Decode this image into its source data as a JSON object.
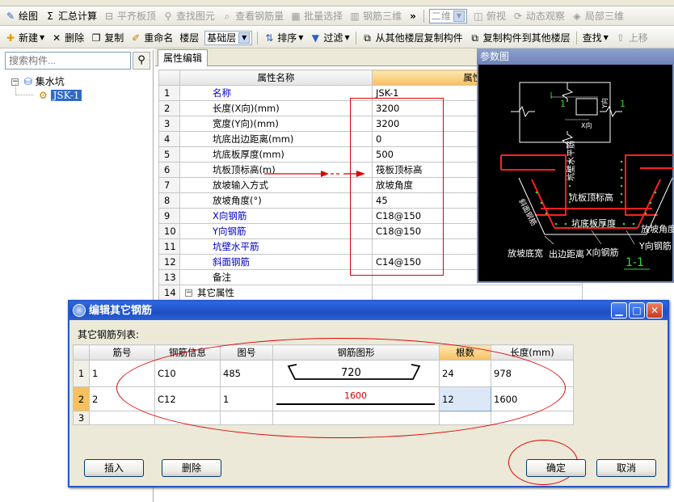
{
  "toolbar1": {
    "items": [
      {
        "label": "绘图",
        "icon": "draw-icon",
        "disabled": false
      },
      {
        "label": "汇总计算",
        "icon": "sigma-icon",
        "disabled": false
      },
      {
        "label": "平齐板顶",
        "icon": "align-icon",
        "disabled": true
      },
      {
        "label": "查找图元",
        "icon": "find-element-icon",
        "disabled": true
      },
      {
        "label": "查看钢筋量",
        "icon": "view-rebar-icon",
        "disabled": true
      },
      {
        "label": "批量选择",
        "icon": "batch-select-icon",
        "disabled": true
      },
      {
        "label": "钢筋三维",
        "icon": "rebar-3d-icon",
        "disabled": true
      }
    ],
    "overflow": "»",
    "view_combo": "二维",
    "top_view": "俯视",
    "dynamic": "动态观察",
    "local3d": "局部三维"
  },
  "toolbar2": {
    "new": "新建",
    "delete": "删除",
    "copy": "复制",
    "rename": "重命名",
    "floor": "楼层",
    "floor_value": "基础层",
    "sort": "排序",
    "filter": "过滤",
    "copy_from": "从其他楼层复制构件",
    "copy_to": "复制构件到其他楼层",
    "find": "查找",
    "move_up": "上移"
  },
  "left": {
    "search_placeholder": "搜索构件...",
    "tree_root": "集水坑",
    "tree_child": "JSK-1"
  },
  "props": {
    "tab": "属性编辑",
    "col_name": "属性名称",
    "col_value": "属性值",
    "rows": [
      {
        "n": "1",
        "name": "名称",
        "value": "JSK-1",
        "blue": true
      },
      {
        "n": "2",
        "name": "长度(X向)(mm)",
        "value": "3200",
        "blue": false
      },
      {
        "n": "3",
        "name": "宽度(Y向)(mm)",
        "value": "3200",
        "blue": false
      },
      {
        "n": "4",
        "name": "坑底出边距离(mm)",
        "value": "0",
        "blue": false
      },
      {
        "n": "5",
        "name": "坑底板厚度(mm)",
        "value": "500",
        "blue": false
      },
      {
        "n": "6",
        "name": "坑板顶标高(m)",
        "value": "筏板顶标高",
        "blue": false
      },
      {
        "n": "7",
        "name": "放坡输入方式",
        "value": "放坡角度",
        "blue": false
      },
      {
        "n": "8",
        "name": "放坡角度(°)",
        "value": "45",
        "blue": false
      },
      {
        "n": "9",
        "name": "X向钢筋",
        "value": "C18@150",
        "blue": true
      },
      {
        "n": "10",
        "name": "Y向钢筋",
        "value": "C18@150",
        "blue": true
      },
      {
        "n": "11",
        "name": "坑壁水平筋",
        "value": "",
        "blue": true
      },
      {
        "n": "12",
        "name": "斜面钢筋",
        "value": "C14@150",
        "blue": true
      },
      {
        "n": "13",
        "name": "备注",
        "value": "",
        "blue": false
      },
      {
        "n": "14",
        "name": "其它属性",
        "value": "",
        "blue": false
      }
    ]
  },
  "ref": {
    "title": "参数图",
    "lbl_1a": "1",
    "lbl_1b": "1",
    "lbl_y": "Y向",
    "lbl_x": "X向",
    "lbl_wall": "坑壁水平筋",
    "lbl_top": "坑板顶标高",
    "lbl_thick": "坑底板厚度",
    "lbl_slope_rebar": "斜面钢筋",
    "lbl_slope_angle": "放坡角度",
    "lbl_y_rebar": "Y向钢筋",
    "lbl_x_rebar": "X向钢筋",
    "lbl_slope_width": "放坡底宽",
    "lbl_edge": "出边距离",
    "lbl_section": "1-1"
  },
  "dialog": {
    "title": "编辑其它钢筋",
    "list_label": "其它钢筋列表:",
    "headers": [
      "筋号",
      "钢筋信息",
      "图号",
      "钢筋图形",
      "根数",
      "长度(mm)"
    ],
    "rows": [
      {
        "rn": "1",
        "no": "1",
        "info": "C10",
        "fig": "485",
        "shape": "720",
        "count": "24",
        "length": "978"
      },
      {
        "rn": "2",
        "no": "2",
        "info": "C12",
        "fig": "1",
        "shape": "1600",
        "count": "12",
        "length": "1600"
      },
      {
        "rn": "3",
        "no": "",
        "info": "",
        "fig": "",
        "shape": "",
        "count": "",
        "length": ""
      }
    ],
    "insert": "插入",
    "delete": "删除",
    "ok": "确定",
    "cancel": "取消"
  },
  "colors": {
    "annotation_red": "#e00000",
    "title_blue": "#1c4fc2",
    "rebar_red": "#ff2020",
    "rebar_green": "#39d439"
  }
}
